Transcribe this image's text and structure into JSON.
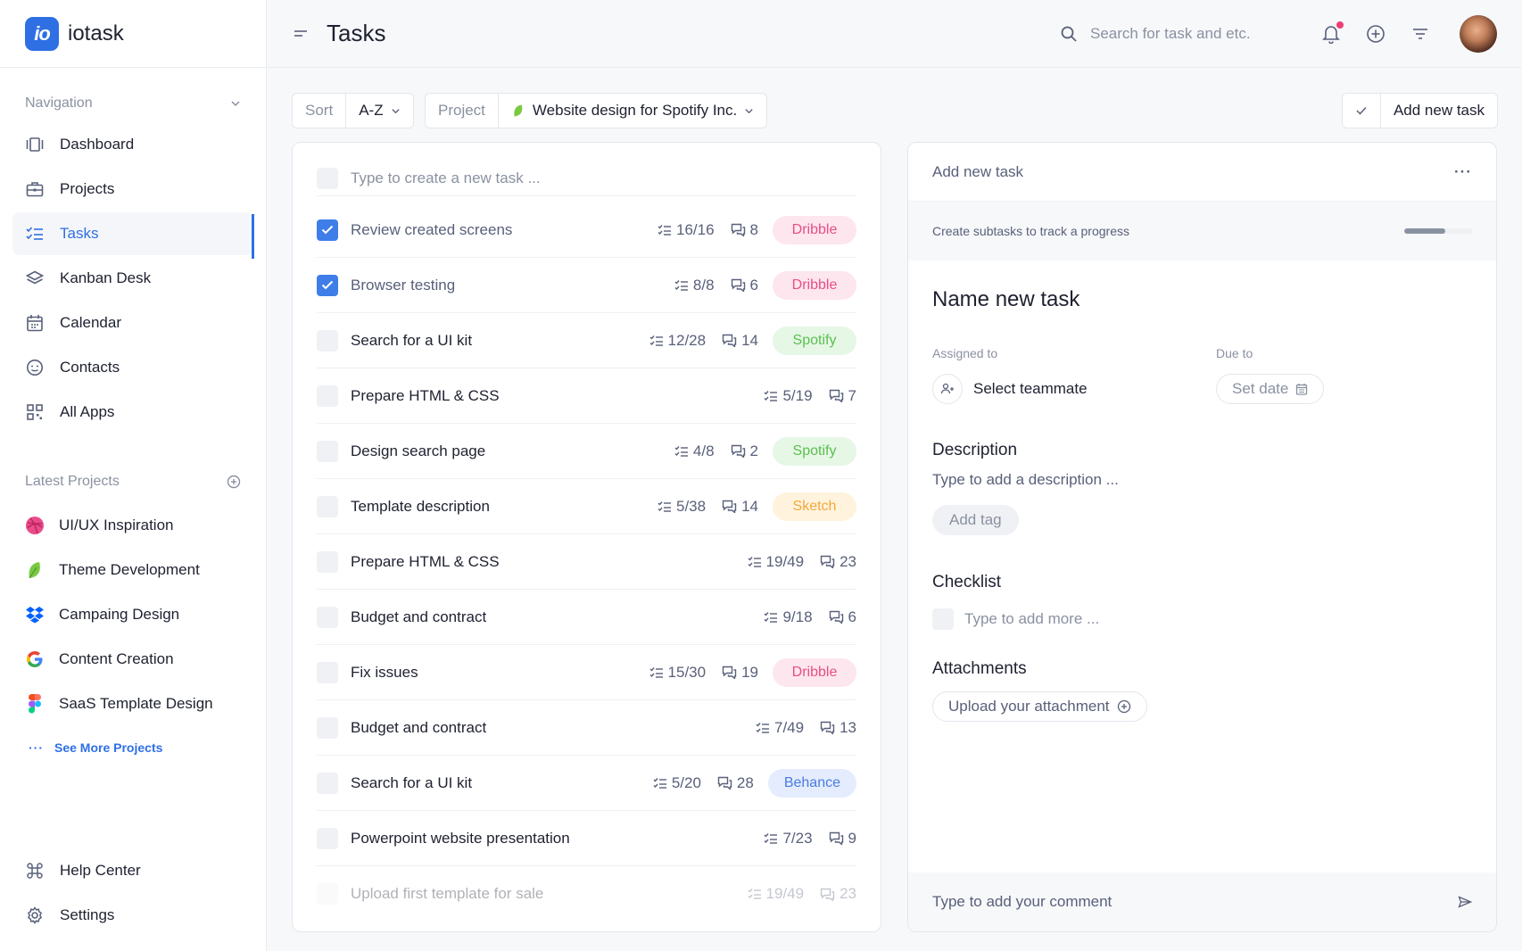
{
  "app": {
    "logo_text": "io",
    "name": "iotask",
    "brand_color": "#2f6fe4"
  },
  "sidebar": {
    "nav_heading": "Navigation",
    "nav_items": [
      {
        "label": "Dashboard",
        "icon": "dashboard-icon"
      },
      {
        "label": "Projects",
        "icon": "briefcase-icon"
      },
      {
        "label": "Tasks",
        "icon": "tasks-icon",
        "active": true
      },
      {
        "label": "Kanban Desk",
        "icon": "layers-icon"
      },
      {
        "label": "Calendar",
        "icon": "calendar-icon"
      },
      {
        "label": "Contacts",
        "icon": "smile-icon"
      },
      {
        "label": "All Apps",
        "icon": "apps-grid-icon"
      }
    ],
    "projects_heading": "Latest Projects",
    "projects": [
      {
        "label": "UI/UX Inspiration",
        "icon": "dribbble-icon"
      },
      {
        "label": "Theme Development",
        "icon": "leaf-icon"
      },
      {
        "label": "Campaing Design",
        "icon": "dropbox-icon"
      },
      {
        "label": "Content Creation",
        "icon": "google-icon"
      },
      {
        "label": "SaaS Template Design",
        "icon": "figma-icon"
      }
    ],
    "see_more": "See More Projects",
    "footer_items": [
      {
        "label": "Help Center",
        "icon": "command-icon"
      },
      {
        "label": "Settings",
        "icon": "gear-icon"
      }
    ]
  },
  "header": {
    "title": "Tasks",
    "search_placeholder": "Search for task and etc."
  },
  "toolbar": {
    "sort_label": "Sort",
    "sort_value": "A-Z",
    "project_label": "Project",
    "project_value": "Website design for Spotify Inc.",
    "add_task_label": "Add new task"
  },
  "tasks": {
    "new_placeholder": "Type to create a new task ...",
    "items": [
      {
        "name": "Review created screens",
        "subtasks": "16/16",
        "comments": "8",
        "tag": "Dribble",
        "tag_type": "dribble",
        "done": true
      },
      {
        "name": "Browser testing",
        "subtasks": "8/8",
        "comments": "6",
        "tag": "Dribble",
        "tag_type": "dribble",
        "done": true
      },
      {
        "name": "Search for a UI kit",
        "subtasks": "12/28",
        "comments": "14",
        "tag": "Spotify",
        "tag_type": "spotify"
      },
      {
        "name": "Prepare HTML & CSS",
        "subtasks": "5/19",
        "comments": "7",
        "tag": "",
        "tag_type": ""
      },
      {
        "name": "Design search page",
        "subtasks": "4/8",
        "comments": "2",
        "tag": "Spotify",
        "tag_type": "spotify"
      },
      {
        "name": "Template description",
        "subtasks": "5/38",
        "comments": "14",
        "tag": "Sketch",
        "tag_type": "sketch"
      },
      {
        "name": "Prepare HTML & CSS",
        "subtasks": "19/49",
        "comments": "23",
        "tag": "",
        "tag_type": ""
      },
      {
        "name": "Budget and contract",
        "subtasks": "9/18",
        "comments": "6",
        "tag": "",
        "tag_type": ""
      },
      {
        "name": "Fix issues",
        "subtasks": "15/30",
        "comments": "19",
        "tag": "Dribble",
        "tag_type": "dribble"
      },
      {
        "name": "Budget and contract",
        "subtasks": "7/49",
        "comments": "13",
        "tag": "",
        "tag_type": ""
      },
      {
        "name": "Search for a UI kit",
        "subtasks": "5/20",
        "comments": "28",
        "tag": "Behance",
        "tag_type": "behance"
      },
      {
        "name": "Powerpoint website presentation",
        "subtasks": "7/23",
        "comments": "9",
        "tag": "",
        "tag_type": ""
      },
      {
        "name": "Upload first template for sale",
        "subtasks": "19/49",
        "comments": "23",
        "tag": "",
        "tag_type": "",
        "faded": true
      }
    ]
  },
  "detail": {
    "header": "Add new task",
    "progress_text": "Create subtasks to track a progress",
    "progress": 0.6,
    "title": "Name new task",
    "assigned_label": "Assigned to",
    "assignee": "Select teammate",
    "due_label": "Due to",
    "due_value": "Set date",
    "description_heading": "Description",
    "description_placeholder": "Type to add a description ...",
    "add_tag": "Add tag",
    "checklist_heading": "Checklist",
    "checklist_placeholder": "Type to add more ...",
    "attachments_heading": "Attachments",
    "upload_label": "Upload your attachment",
    "comment_placeholder": "Type to add your comment"
  }
}
